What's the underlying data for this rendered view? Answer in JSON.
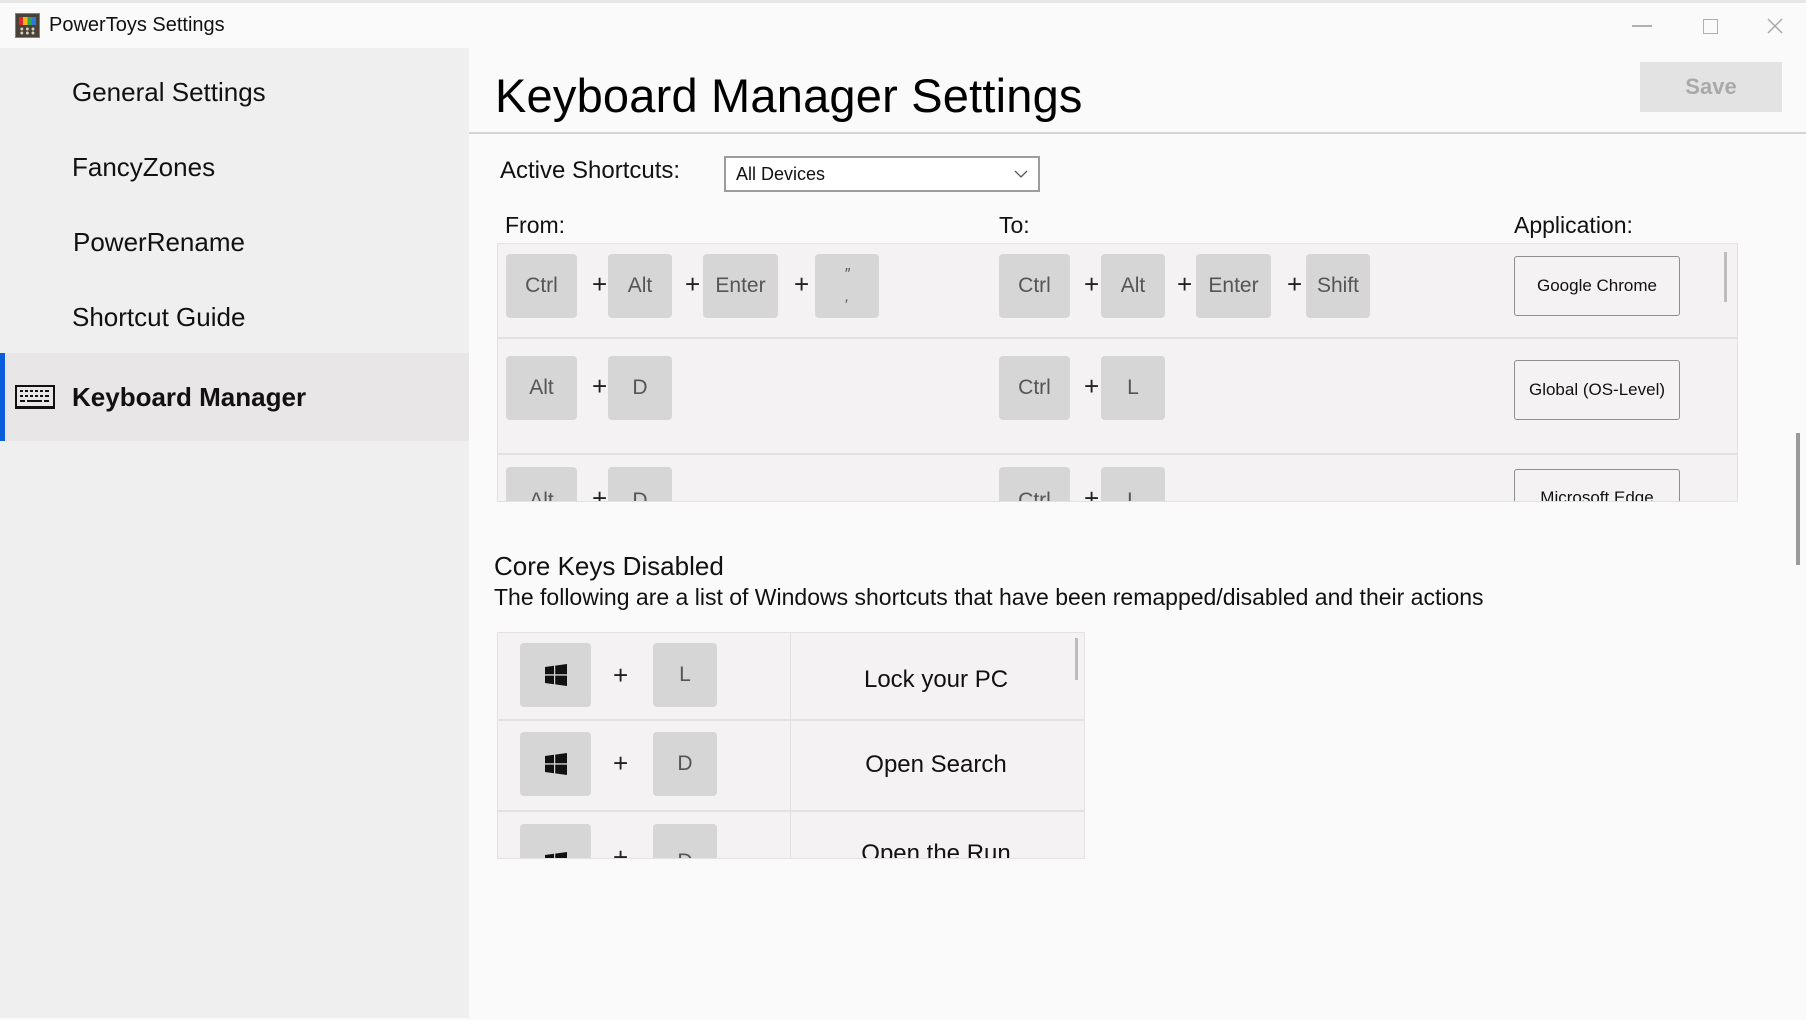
{
  "window": {
    "title": "PowerToys Settings",
    "app_icon": "powertoys-icon",
    "controls": [
      "minimize",
      "maximize",
      "close"
    ]
  },
  "sidebar": {
    "items": [
      {
        "label": "General Settings",
        "active": false
      },
      {
        "label": "FancyZones",
        "active": false
      },
      {
        "label": "PowerRename",
        "active": false
      },
      {
        "label": "Shortcut Guide",
        "active": false
      },
      {
        "label": "Keyboard Manager",
        "active": true,
        "icon": "keyboard-icon"
      }
    ],
    "accent_color": "#0a5ddb"
  },
  "header": {
    "title": "Keyboard Manager Settings",
    "save_label": "Save"
  },
  "active_shortcuts": {
    "label": "Active Shortcuts:",
    "selected": "All Devices"
  },
  "shortcuts": {
    "headers": {
      "from": "From:",
      "to": "To:",
      "application": "Application:"
    },
    "rows": [
      {
        "from": [
          "Ctrl",
          "Alt",
          "Enter",
          "\" '"
        ],
        "to": [
          "Ctrl",
          "Alt",
          "Enter",
          "Shift"
        ],
        "application": "Google Chrome"
      },
      {
        "from": [
          "Alt",
          "D"
        ],
        "to": [
          "Ctrl",
          "L"
        ],
        "application": "Global (OS-Level)"
      },
      {
        "from": [
          "Alt",
          "D"
        ],
        "to": [
          "Ctrl",
          "L"
        ],
        "application": "Microsoft Edge"
      }
    ],
    "separator": "+"
  },
  "core_keys": {
    "title": "Core Keys Disabled",
    "description": "The following are a list of Windows shortcuts that have been remapped/disabled and their actions",
    "rows": [
      {
        "keys": [
          "Win",
          "L"
        ],
        "action": "Lock your PC"
      },
      {
        "keys": [
          "Win",
          "D"
        ],
        "action": "Open Search"
      },
      {
        "keys": [
          "Win",
          "D"
        ],
        "action": "Open the Run"
      }
    ]
  }
}
